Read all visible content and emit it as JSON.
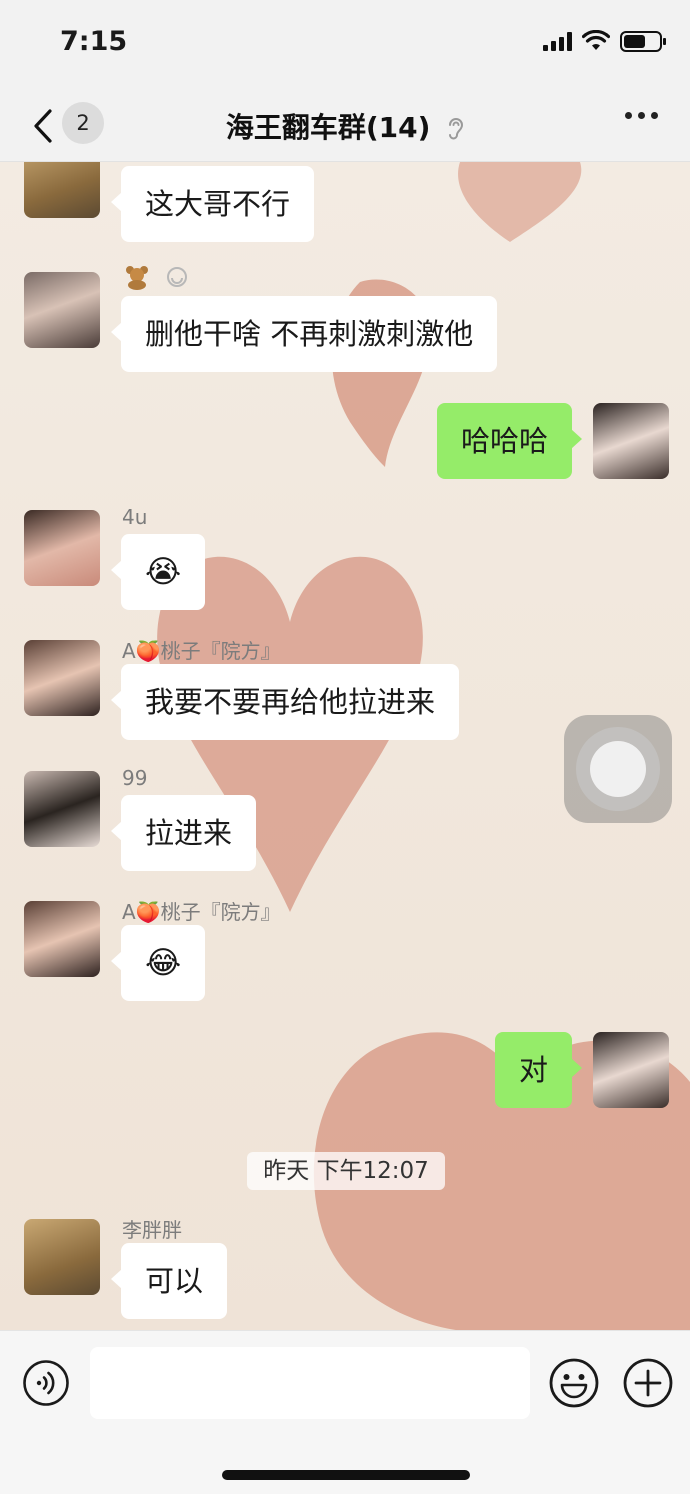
{
  "status_bar": {
    "time": "7:15"
  },
  "nav": {
    "back_count": "2",
    "title": "海王翻车群(14)"
  },
  "messages": [
    {
      "side": "in",
      "text": "这大哥不行",
      "sender": ""
    },
    {
      "side": "in",
      "text": "删他干啥 不再刺激刺激他",
      "sender": ""
    },
    {
      "side": "out",
      "text": "哈哈哈"
    },
    {
      "side": "in",
      "text": "😭",
      "sender": "4u"
    },
    {
      "side": "in",
      "text": "我要不要再给他拉进来",
      "sender": "A🍑桃子『院方』"
    },
    {
      "side": "in",
      "text": "拉进来",
      "sender": "99"
    },
    {
      "side": "in",
      "text": "😂",
      "sender": "A🍑桃子『院方』"
    },
    {
      "side": "out",
      "text": "对"
    },
    {
      "side": "in",
      "text": "可以",
      "sender": "李胖胖"
    }
  ],
  "timestamp": "昨天 下午12:07",
  "input": {
    "value": ""
  },
  "colors": {
    "out_bubble": "#95ec69",
    "in_bubble": "#ffffff",
    "heart": "#d59a86"
  }
}
